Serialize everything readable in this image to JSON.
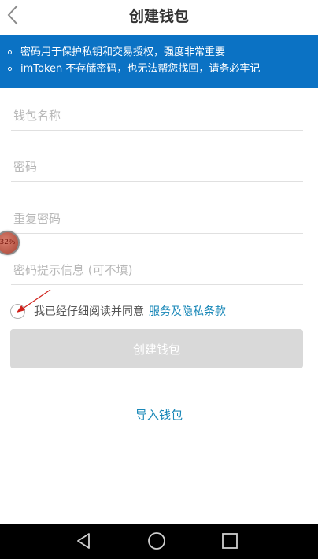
{
  "header": {
    "title": "创建钱包"
  },
  "notice": {
    "lines": [
      "密码用于保护私钥和交易授权，强度非常重要",
      "imToken 不存储密码，也无法帮您找回，请务必牢记"
    ]
  },
  "form": {
    "wallet_name_placeholder": "钱包名称",
    "password_placeholder": "密码",
    "repeat_password_placeholder": "重复密码",
    "password_hint_placeholder": "密码提示信息 (可不填)"
  },
  "overlay": {
    "badge_text": "32%"
  },
  "agreement": {
    "text": "我已经仔细阅读并同意",
    "link": "服务及隐私条款"
  },
  "buttons": {
    "create": "创建钱包",
    "import": "导入钱包"
  },
  "colors": {
    "notice_bg": "#0b72c4",
    "link": "#1a88b8",
    "disabled_button": "#d9d9d9",
    "annotation_arrow": "#d0201a"
  },
  "icons": {
    "back": "back-chevron-icon",
    "nav_back": "triangle-back-icon",
    "nav_home": "circle-home-icon",
    "nav_recent": "square-recents-icon"
  }
}
